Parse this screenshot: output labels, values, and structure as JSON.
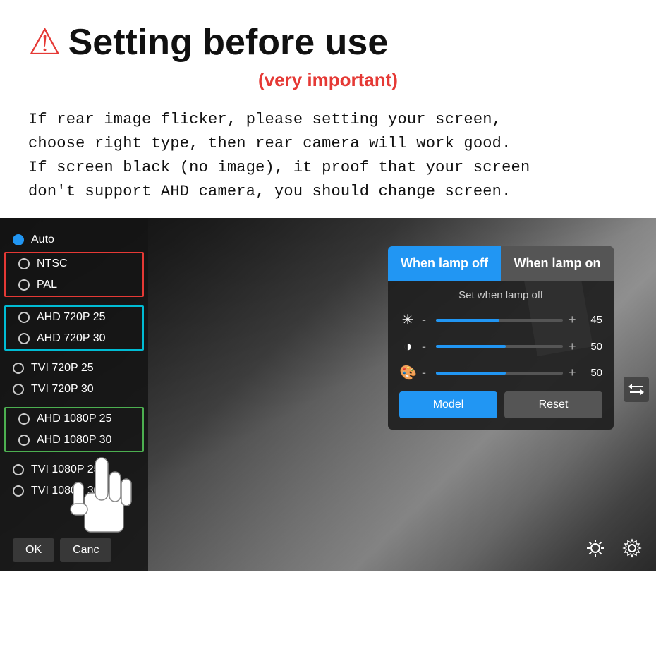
{
  "page": {
    "title": "Setting before use",
    "subtitle": "(very important)",
    "warning_icon": "⚠",
    "description_line1": "If rear image flicker, please setting your screen,",
    "description_line2": "choose right type, then rear camera will work good.",
    "description_line3": "If screen black (no image), it proof that your screen",
    "description_line4": "don't support AHD camera, you should change screen."
  },
  "left_panel": {
    "items": [
      {
        "label": "Auto",
        "state": "active",
        "highlight": "none"
      },
      {
        "label": "NTSC",
        "state": "inactive",
        "highlight": "red"
      },
      {
        "label": "PAL",
        "state": "inactive",
        "highlight": "red"
      },
      {
        "label": "AHD 720P 25",
        "state": "inactive",
        "highlight": "cyan"
      },
      {
        "label": "AHD 720P 30",
        "state": "inactive",
        "highlight": "cyan"
      },
      {
        "label": "TVI 720P 25",
        "state": "inactive",
        "highlight": "none"
      },
      {
        "label": "TVI 720P 30",
        "state": "inactive",
        "highlight": "none"
      },
      {
        "label": "AHD 1080P 25",
        "state": "inactive",
        "highlight": "green"
      },
      {
        "label": "AHD 1080P 30",
        "state": "inactive",
        "highlight": "green"
      },
      {
        "label": "TVI 1080P 25",
        "state": "inactive",
        "highlight": "none"
      },
      {
        "label": "TVI 1080P 30",
        "state": "inactive",
        "highlight": "none"
      }
    ],
    "ok_label": "OK",
    "cancel_label": "Canc"
  },
  "right_panel": {
    "tab_lamp_off": "When lamp off",
    "tab_lamp_on": "When lamp on",
    "subtitle": "Set when lamp off",
    "sliders": [
      {
        "icon": "☀",
        "value": 45,
        "fill_pct": 50
      },
      {
        "icon": "◑",
        "value": 50,
        "fill_pct": 55
      },
      {
        "icon": "🎨",
        "value": 50,
        "fill_pct": 55
      }
    ],
    "model_label": "Model",
    "reset_label": "Reset"
  }
}
